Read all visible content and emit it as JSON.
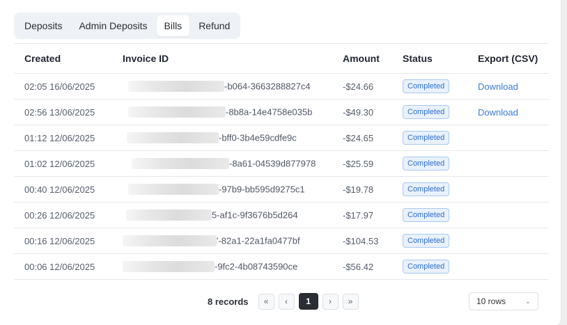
{
  "tabs": [
    {
      "label": "Deposits"
    },
    {
      "label": "Admin Deposits"
    },
    {
      "label": "Bills"
    },
    {
      "label": "Refund"
    }
  ],
  "active_tab": "Bills",
  "table": {
    "headers": {
      "created": "Created",
      "invoice": "Invoice ID",
      "amount": "Amount",
      "status": "Status",
      "export": "Export (CSV)"
    },
    "rows": [
      {
        "created": "02:05 16/06/2025",
        "invoice": "-b064-3663288827c4",
        "amount": "-$24.66",
        "status": "Completed",
        "export": "Download"
      },
      {
        "created": "02:56 13/06/2025",
        "invoice": "-8b8a-14e4758e035b",
        "amount": "-$49.30",
        "status": "Completed",
        "export": "Download"
      },
      {
        "created": "01:12 12/06/2025",
        "invoice": "-bff0-3b4e59cdfe9c",
        "amount": "-$24.65",
        "status": "Completed",
        "export": ""
      },
      {
        "created": "01:02 12/06/2025",
        "invoice": "-8a61-04539d877978",
        "amount": "-$25.59",
        "status": "Completed",
        "export": ""
      },
      {
        "created": "00:40 12/06/2025",
        "invoice": "-97b9-bb595d9275c1",
        "amount": "-$19.78",
        "status": "Completed",
        "export": ""
      },
      {
        "created": "00:26 12/06/2025",
        "invoice": "5-af1c-9f3676b5d264",
        "amount": "-$17.97",
        "status": "Completed",
        "export": ""
      },
      {
        "created": "00:16 12/06/2025",
        "invoice": "'-82a1-22a1fa0477bf",
        "amount": "-$104.53",
        "status": "Completed",
        "export": ""
      },
      {
        "created": "00:06 12/06/2025",
        "invoice": "-9fc2-4b08743590ce",
        "amount": "-$56.42",
        "status": "Completed",
        "export": ""
      }
    ]
  },
  "pagination": {
    "records_label": "8 records",
    "first_icon": "«",
    "prev_icon": "‹",
    "current_page": "1",
    "next_icon": "›",
    "last_icon": "»",
    "rows_per_page": "10 rows",
    "dropdown_icon": "⌄"
  }
}
